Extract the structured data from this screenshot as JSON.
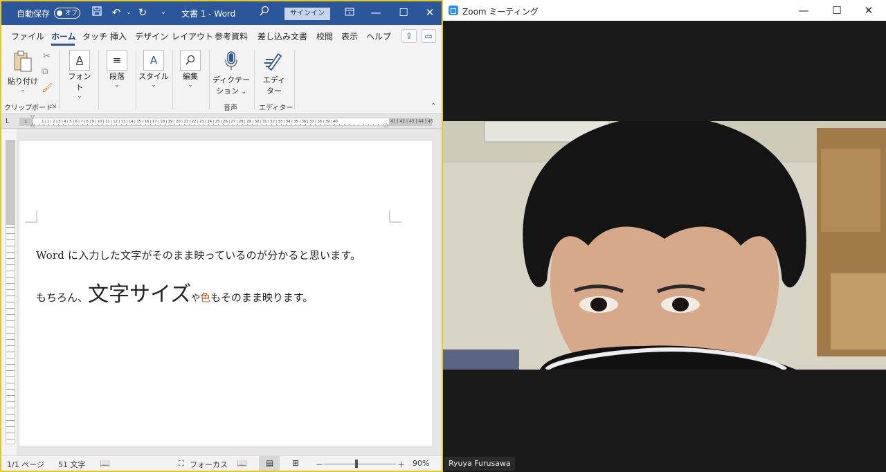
{
  "word": {
    "titlebar": {
      "autosave_label": "自動保存",
      "autosave_state": "オフ",
      "doc_title": "文書 1 - Word",
      "signin_label": "サインイン"
    },
    "tabs": [
      "ファイル",
      "ホーム",
      "タッチ",
      "挿入",
      "デザイン",
      "レイアウト",
      "参考資料",
      "差し込み文書",
      "校閲",
      "表示",
      "ヘルプ"
    ],
    "active_tab": "ホーム",
    "ribbon": {
      "paste_label": "貼り付け",
      "font_label": "フォント",
      "paragraph_label": "段落",
      "style_label": "スタイル",
      "edit_label": "編集",
      "dictation_label_1": "ディクテー",
      "dictation_label_2": "ション",
      "editor_label_1": "エディ",
      "editor_label_2": "ター",
      "group_clipboard": "クリップボード",
      "group_voice": "音声",
      "group_editor": "エディター"
    },
    "ruler": {
      "corner": "L",
      "label_left": "1",
      "labels": "1 | 1 | 2 | 3 | 4 | 5 | 6 | 7 | 8 | 9 | 10 | 11 | 12 | 13 | 14 | 15 | 16 | 17 | 18 | 19 | 20 | 21 | 22 | 23 | 24 | 25 | 26 | 27 | 28 | 29 | 30 | 31 | 32 | 33 | 34 | 35 | 36 | 37 | 38 | 39 | 40",
      "labels_right": "41 | 42 | 43 | 44 | 45"
    },
    "document": {
      "line1": "Word に入力した文字がそのまま映っているのが分かると思います。",
      "line2_part1": "もちろん、",
      "line2_big": "文字サイズ",
      "line2_small": "や",
      "line2_red": "色",
      "line2_rest": "もそのまま映ります。",
      "red_color": "#c55a11"
    },
    "status": {
      "page": "1/1 ページ",
      "words": "51 文字",
      "focus": "フォーカス",
      "zoom_minus": "－",
      "zoom_plus": "＋",
      "zoom": "90%",
      "zoom_fraction": 0.45
    },
    "accent_color": "#2b579a"
  },
  "zoom": {
    "title": "Zoom ミーティング",
    "participant_name": "Ryuya Furusawa"
  }
}
